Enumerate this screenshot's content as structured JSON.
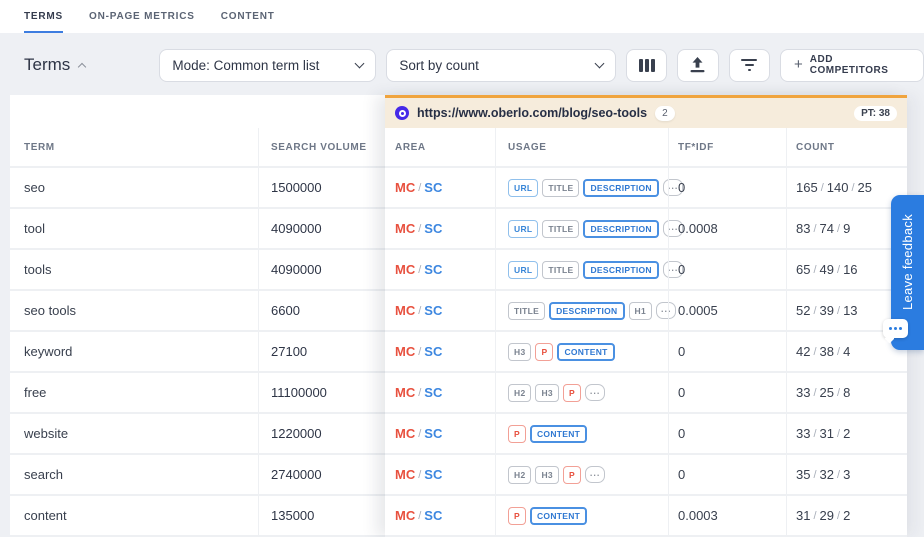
{
  "tabs": [
    {
      "label": "TERMS",
      "active": true
    },
    {
      "label": "ON-PAGE METRICS",
      "active": false
    },
    {
      "label": "CONTENT",
      "active": false
    }
  ],
  "toolbar": {
    "title": "Terms",
    "mode_dropdown_value": "Mode: Common term list",
    "sort_dropdown_value": "Sort by count",
    "add_competitors_label": "ADD COMPETITORS"
  },
  "competitor_header": {
    "url": "https://www.oberlo.com/blog/seo-tools",
    "pages_badge": "2",
    "pt_label": "PT: 38"
  },
  "table": {
    "columns": [
      "TERM",
      "SEARCH VOLUME",
      "AREA",
      "USAGE",
      "TF*IDF",
      "COUNT"
    ],
    "rows": [
      {
        "term": "seo",
        "volume": "1500000",
        "area": [
          "MC",
          "SC"
        ],
        "usage": [
          {
            "label": "URL",
            "style": "blue"
          },
          {
            "label": "TITLE",
            "style": "gray"
          },
          {
            "label": "DESCRIPTION",
            "style": "blue-bold"
          },
          {
            "label": "...",
            "style": "more"
          }
        ],
        "tfidf": "0",
        "count": [
          "165",
          "140",
          "25"
        ]
      },
      {
        "term": "tool",
        "volume": "4090000",
        "area": [
          "MC",
          "SC"
        ],
        "usage": [
          {
            "label": "URL",
            "style": "blue"
          },
          {
            "label": "TITLE",
            "style": "gray"
          },
          {
            "label": "DESCRIPTION",
            "style": "blue-bold"
          },
          {
            "label": "...",
            "style": "more"
          }
        ],
        "tfidf": "0.0008",
        "count": [
          "83",
          "74",
          "9"
        ]
      },
      {
        "term": "tools",
        "volume": "4090000",
        "area": [
          "MC",
          "SC"
        ],
        "usage": [
          {
            "label": "URL",
            "style": "blue"
          },
          {
            "label": "TITLE",
            "style": "gray"
          },
          {
            "label": "DESCRIPTION",
            "style": "blue-bold"
          },
          {
            "label": "...",
            "style": "more"
          }
        ],
        "tfidf": "0",
        "count": [
          "65",
          "49",
          "16"
        ]
      },
      {
        "term": "seo tools",
        "volume": "6600",
        "area": [
          "MC",
          "SC"
        ],
        "usage": [
          {
            "label": "TITLE",
            "style": "gray"
          },
          {
            "label": "DESCRIPTION",
            "style": "blue-bold"
          },
          {
            "label": "H1",
            "style": "gray"
          },
          {
            "label": "...",
            "style": "more"
          }
        ],
        "tfidf": "0.0005",
        "count": [
          "52",
          "39",
          "13"
        ]
      },
      {
        "term": "keyword",
        "volume": "27100",
        "area": [
          "MC",
          "SC"
        ],
        "usage": [
          {
            "label": "H3",
            "style": "gray"
          },
          {
            "label": "P",
            "style": "red"
          },
          {
            "label": "CONTENT",
            "style": "blue-bold"
          }
        ],
        "tfidf": "0",
        "count": [
          "42",
          "38",
          "4"
        ]
      },
      {
        "term": "free",
        "volume": "11100000",
        "area": [
          "MC",
          "SC"
        ],
        "usage": [
          {
            "label": "H2",
            "style": "gray"
          },
          {
            "label": "H3",
            "style": "gray"
          },
          {
            "label": "P",
            "style": "red"
          },
          {
            "label": "...",
            "style": "more"
          }
        ],
        "tfidf": "0",
        "count": [
          "33",
          "25",
          "8"
        ]
      },
      {
        "term": "website",
        "volume": "1220000",
        "area": [
          "MC",
          "SC"
        ],
        "usage": [
          {
            "label": "P",
            "style": "red"
          },
          {
            "label": "CONTENT",
            "style": "blue-bold"
          }
        ],
        "tfidf": "0",
        "count": [
          "33",
          "31",
          "2"
        ]
      },
      {
        "term": "search",
        "volume": "2740000",
        "area": [
          "MC",
          "SC"
        ],
        "usage": [
          {
            "label": "H2",
            "style": "gray"
          },
          {
            "label": "H3",
            "style": "gray"
          },
          {
            "label": "P",
            "style": "red"
          },
          {
            "label": "...",
            "style": "more"
          }
        ],
        "tfidf": "0",
        "count": [
          "35",
          "32",
          "3"
        ]
      },
      {
        "term": "content",
        "volume": "135000",
        "area": [
          "MC",
          "SC"
        ],
        "usage": [
          {
            "label": "P",
            "style": "red"
          },
          {
            "label": "CONTENT",
            "style": "blue-bold"
          }
        ],
        "tfidf": "0.0003",
        "count": [
          "31",
          "29",
          "2"
        ]
      }
    ]
  },
  "feedback": {
    "label": "Leave feedback"
  },
  "icons": {
    "mode_dropdown": "chevron-down",
    "sort_dropdown": "chevron-down",
    "terms_caret": "chevron-up",
    "toolbar_buttons": [
      "columns-icon",
      "upload-icon",
      "filter-icon"
    ],
    "add_button": "plus-icon",
    "usage_overflow": "ellipsis-icon",
    "url_favicon": "oberlo-favicon",
    "feedback": "speech-bubble-icon"
  },
  "colors": {
    "active_tab_underline": "#3d7de0",
    "competitor_header_bg": "#f6ecdc",
    "competitor_header_border": "#f0a43e",
    "mc_red": "#e8513f",
    "sc_blue": "#3d87e0",
    "badge_blue": "#4a90e2",
    "badge_red": "#e8513f",
    "feedback_blue": "#2b7ce0",
    "favicon_purple": "#4629e8"
  }
}
